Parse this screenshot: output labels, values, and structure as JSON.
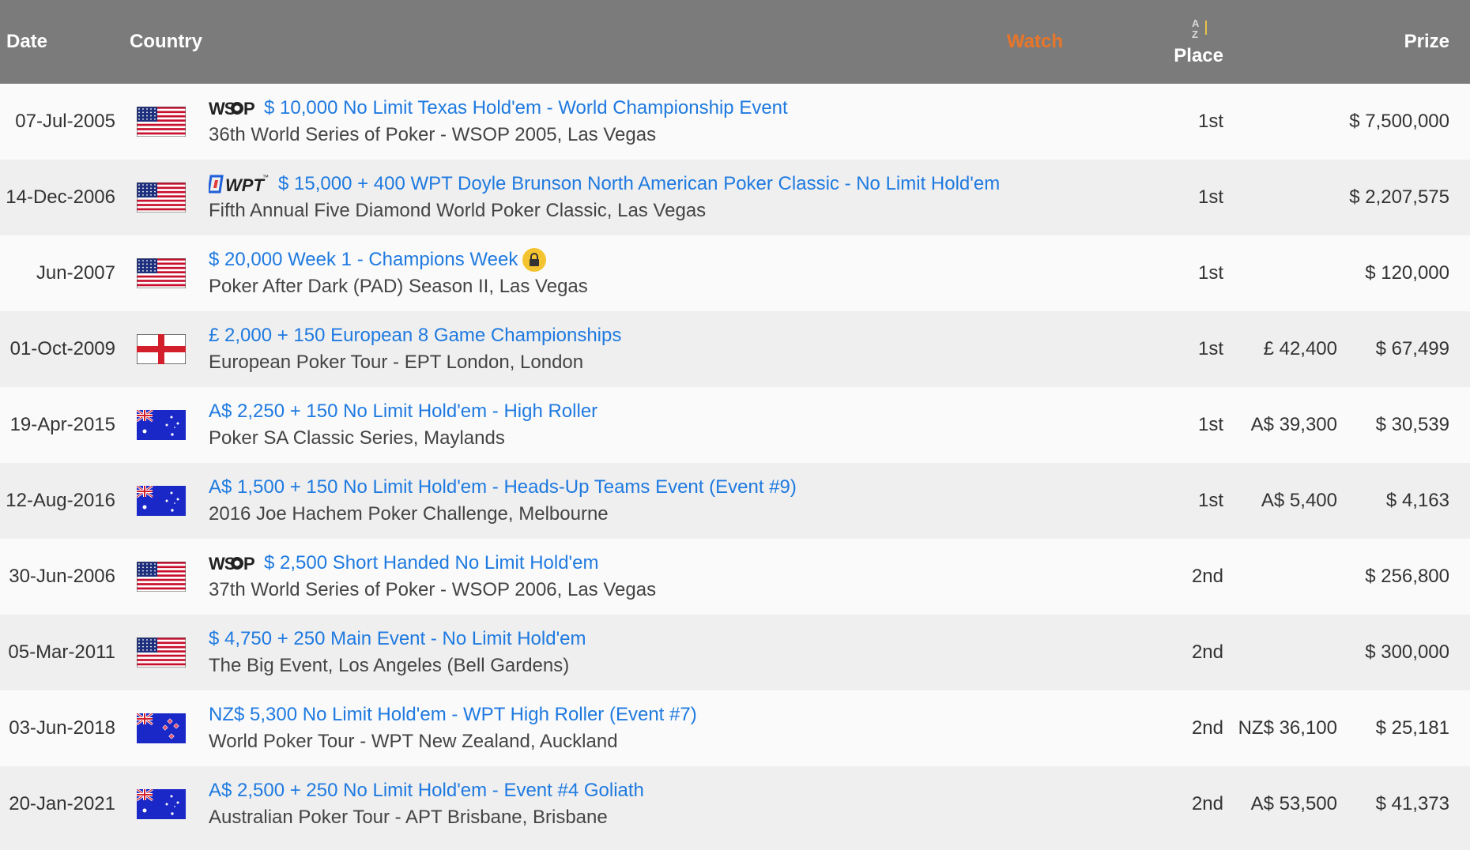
{
  "header": {
    "date": "Date",
    "country": "Country",
    "watch": "Watch",
    "sort_icon": "A Z",
    "place": "Place",
    "prize": "Prize"
  },
  "colors": {
    "header_bg": "#7b7b7b",
    "link": "#1f7ae0",
    "watch": "#e8762a"
  },
  "rows": [
    {
      "date": "07-Jul-2005",
      "flag": "usa-flag-icon",
      "logo": "wsop",
      "title": "$ 10,000 No Limit Texas Hold'em - World Championship Event",
      "subtitle": "36th World Series of Poker - WSOP 2005, Las Vegas",
      "place": "1st",
      "local": "",
      "prize": "$ 7,500,000"
    },
    {
      "date": "14-Dec-2006",
      "flag": "usa-flag-icon",
      "logo": "wpt",
      "title": "$ 15,000 + 400 WPT Doyle Brunson North American Poker Classic - No Limit Hold'em",
      "subtitle": "Fifth Annual Five Diamond World Poker Classic, Las Vegas",
      "place": "1st",
      "local": "",
      "prize": "$ 2,207,575"
    },
    {
      "date": "Jun-2007",
      "flag": "usa-flag-icon",
      "logo": "",
      "lock": true,
      "title": "$ 20,000 Week 1 - Champions Week",
      "subtitle": "Poker After Dark (PAD) Season II, Las Vegas",
      "place": "1st",
      "local": "",
      "prize": "$ 120,000"
    },
    {
      "date": "01-Oct-2009",
      "flag": "england-flag-icon",
      "logo": "",
      "title": "£ 2,000 + 150 European 8 Game Championships",
      "subtitle": "European Poker Tour - EPT London, London",
      "place": "1st",
      "local": "£ 42,400",
      "prize": "$ 67,499"
    },
    {
      "date": "19-Apr-2015",
      "flag": "australia-flag-icon",
      "logo": "",
      "title": "A$ 2,250 + 150 No Limit Hold'em - High Roller",
      "subtitle": "Poker SA Classic Series, Maylands",
      "place": "1st",
      "local": "A$ 39,300",
      "prize": "$ 30,539"
    },
    {
      "date": "12-Aug-2016",
      "flag": "australia-flag-icon",
      "logo": "",
      "title": "A$ 1,500 + 150 No Limit Hold'em - Heads-Up Teams Event (Event #9)",
      "subtitle": "2016 Joe Hachem Poker Challenge, Melbourne",
      "place": "1st",
      "local": "A$ 5,400",
      "prize": "$ 4,163"
    },
    {
      "date": "30-Jun-2006",
      "flag": "usa-flag-icon",
      "logo": "wsop",
      "title": "$ 2,500 Short Handed No Limit Hold'em",
      "subtitle": "37th World Series of Poker - WSOP 2006, Las Vegas",
      "place": "2nd",
      "local": "",
      "prize": "$ 256,800"
    },
    {
      "date": "05-Mar-2011",
      "flag": "usa-flag-icon",
      "logo": "",
      "title": "$ 4,750 + 250 Main Event - No Limit Hold'em",
      "subtitle": "The Big Event, Los Angeles (Bell Gardens)",
      "place": "2nd",
      "local": "",
      "prize": "$ 300,000"
    },
    {
      "date": "03-Jun-2018",
      "flag": "new-zealand-flag-icon",
      "logo": "",
      "title": "NZ$ 5,300 No Limit Hold'em - WPT High Roller (Event #7)",
      "subtitle": "World Poker Tour - WPT New Zealand, Auckland",
      "place": "2nd",
      "local": "NZ$ 36,100",
      "prize": "$ 25,181"
    },
    {
      "date": "20-Jan-2021",
      "flag": "australia-flag-icon",
      "logo": "",
      "title": "A$ 2,500 + 250 No Limit Hold'em - Event #4 Goliath",
      "subtitle": "Australian Poker Tour - APT Brisbane, Brisbane",
      "place": "2nd",
      "local": "A$ 53,500",
      "prize": "$ 41,373"
    }
  ]
}
